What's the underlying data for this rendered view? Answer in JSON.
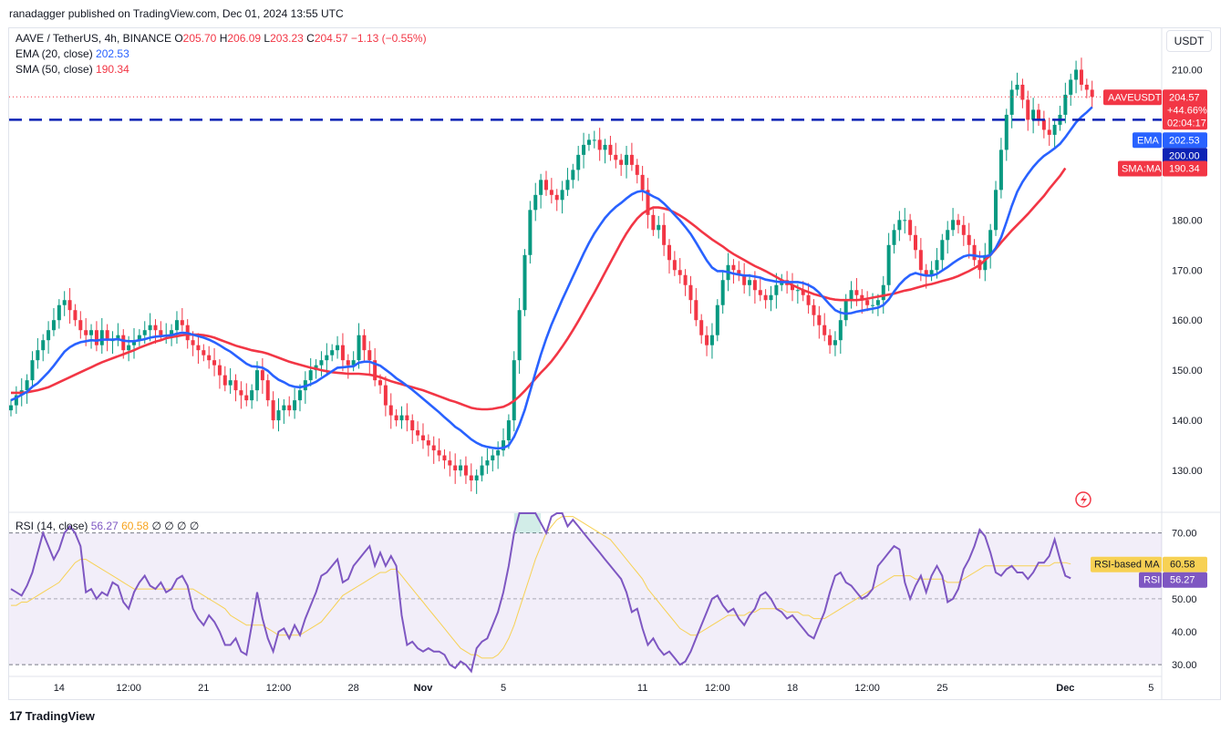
{
  "header": {
    "publisher": "ranadagger published on TradingView.com, Dec 01, 2024 13:55 UTC"
  },
  "legend": {
    "symbol": "AAVE / TetherUS, 4h, BINANCE",
    "o_label": "O",
    "o": "205.70",
    "h_label": "H",
    "h": "206.09",
    "l_label": "L",
    "l": "203.23",
    "c_label": "C",
    "c": "204.57",
    "change": "−1.13 (−0.55%)",
    "ema_label": "EMA (20, close)",
    "ema": "202.53",
    "sma_label": "SMA (50, close)",
    "sma": "190.34"
  },
  "rsi_legend": {
    "label": "RSI (14, close)",
    "rsi": "56.27",
    "ma": "60.58",
    "extra": "∅ ∅ ∅ ∅"
  },
  "currency_button": "USDT",
  "footer": {
    "brand": "TradingView",
    "logo": "17"
  },
  "colors": {
    "up": "#089981",
    "down": "#f23645",
    "ema": "#2962ff",
    "sma": "#f23645",
    "rsi": "#7e57c2",
    "rsi_ma": "#f7d154",
    "level": "#0d23b5"
  },
  "chart_data": [
    {
      "type": "candlestick",
      "title": "AAVE / TetherUS, 4h, BINANCE",
      "ylim": [
        122,
        217
      ],
      "y_ticks": [
        "210.00",
        "200.00",
        "190.00",
        "180.00",
        "170.00",
        "160.00",
        "150.00",
        "140.00",
        "130.00"
      ],
      "x_ticks": [
        {
          "label": "14",
          "i": 9
        },
        {
          "label": "12:00",
          "i": 22
        },
        {
          "label": "21",
          "i": 36
        },
        {
          "label": "12:00",
          "i": 50
        },
        {
          "label": "28",
          "i": 64
        },
        {
          "label": "Nov",
          "i": 77
        },
        {
          "label": "5",
          "i": 92
        },
        {
          "label": "11",
          "i": 118
        },
        {
          "label": "12:00",
          "i": 132
        },
        {
          "label": "18",
          "i": 146
        },
        {
          "label": "12:00",
          "i": 160
        },
        {
          "label": "25",
          "i": 174
        },
        {
          "label": "Dec",
          "i": 197
        },
        {
          "label": "5",
          "i": 213
        }
      ],
      "close": [
        143,
        145,
        146,
        148,
        152,
        154,
        156,
        158,
        160,
        163,
        164,
        162,
        160,
        158,
        157,
        158,
        155,
        158,
        156,
        156,
        157,
        154,
        155,
        156,
        157,
        158,
        159,
        158,
        157,
        157,
        158,
        160,
        159,
        156,
        155,
        154,
        153,
        152,
        151,
        149,
        147,
        148,
        146,
        145,
        144,
        146,
        150,
        148,
        144,
        140,
        142,
        143,
        142,
        144,
        146,
        148,
        150,
        151,
        152,
        153,
        154,
        155,
        152,
        151,
        152,
        157,
        154,
        152,
        148,
        147,
        143,
        141,
        140,
        141,
        140,
        138,
        137,
        136,
        135,
        134,
        133,
        132,
        131,
        130,
        131,
        129,
        128,
        129,
        131,
        132,
        133,
        134,
        136,
        140,
        152,
        162,
        173,
        182,
        185,
        188,
        186,
        185,
        184,
        186,
        188,
        190,
        193,
        195,
        196,
        196,
        194,
        195,
        193,
        192,
        191,
        193,
        191,
        189,
        186,
        181,
        178,
        179,
        175,
        172,
        170,
        169,
        167,
        164,
        160,
        157,
        155,
        157,
        163,
        168,
        171,
        170,
        169,
        167,
        168,
        166,
        165,
        164,
        165,
        167,
        168,
        167,
        166,
        166,
        165,
        163,
        161,
        159,
        157,
        155,
        156,
        160,
        164,
        166,
        165,
        164,
        163,
        163,
        164,
        167,
        175,
        178,
        180,
        180,
        177,
        174,
        170,
        169,
        170,
        172,
        176,
        178,
        180,
        179,
        177,
        175,
        172,
        170,
        173,
        178,
        186,
        194,
        201,
        206,
        207,
        204,
        200,
        202,
        200,
        198,
        197,
        199,
        201,
        205,
        208,
        210,
        207,
        206,
        204.57
      ],
      "ema": [
        144,
        144.5,
        145.1,
        145.7,
        146.7,
        147.4,
        148.5,
        149.6,
        150.9,
        152.3,
        153.7,
        154.6,
        155.2,
        155.6,
        155.8,
        156.0,
        155.9,
        156.1,
        156.1,
        156.1,
        156.2,
        155.9,
        155.8,
        155.8,
        156.0,
        156.2,
        156.5,
        156.7,
        156.8,
        156.9,
        157.0,
        157.3,
        157.5,
        157.4,
        157.1,
        156.8,
        156.5,
        156.1,
        155.6,
        155.0,
        154.3,
        153.7,
        152.9,
        152.1,
        151.3,
        150.8,
        150.7,
        150.5,
        149.9,
        148.9,
        148.1,
        147.6,
        147.0,
        146.7,
        146.6,
        146.8,
        147.2,
        147.7,
        148.4,
        149.1,
        149.8,
        150.5,
        150.6,
        150.7,
        150.8,
        151.5,
        151.7,
        151.7,
        151.3,
        150.9,
        150.1,
        149.3,
        148.4,
        147.7,
        146.9,
        146.1,
        145.2,
        144.3,
        143.4,
        142.5,
        141.6,
        140.6,
        139.7,
        138.7,
        138.0,
        137.1,
        136.2,
        135.5,
        135.0,
        134.7,
        134.5,
        134.4,
        134.5,
        135.0,
        136.7,
        139.1,
        142.1,
        145.8,
        149.5,
        153.1,
        156.3,
        159.1,
        161.6,
        164.1,
        166.4,
        168.7,
        171.0,
        173.3,
        175.4,
        177.3,
        178.9,
        180.4,
        181.6,
        182.6,
        183.4,
        184.3,
        185.1,
        185.6,
        185.8,
        185.3,
        184.7,
        184.2,
        183.3,
        182.2,
        181.0,
        179.9,
        178.6,
        177.2,
        175.5,
        173.7,
        171.9,
        170.5,
        169.8,
        169.8,
        169.6,
        169.3,
        169.1,
        168.9,
        168.9,
        168.7,
        168.5,
        168.1,
        167.9,
        167.7,
        167.6,
        167.6,
        167.6,
        167.6,
        167.4,
        167.0,
        166.4,
        165.5,
        164.3,
        163.1,
        162.0,
        161.5,
        161.3,
        161.4,
        161.7,
        161.9,
        162.1,
        162.3,
        162.5,
        163.0,
        164.1,
        165.7,
        167.1,
        168.2,
        169.0,
        169.4,
        169.1,
        168.9,
        168.9,
        169.2,
        169.9,
        170.6,
        171.4,
        172.1,
        172.7,
        173.0,
        172.9,
        172.7,
        172.7,
        173.0,
        174.4,
        176.5,
        179.6,
        182.8,
        185.6,
        187.6,
        189.2,
        190.6,
        191.8,
        192.8,
        193.5,
        194.3,
        195.2,
        196.5,
        198.0,
        199.5,
        200.6,
        201.5,
        202.53
      ],
      "sma": [
        145.5,
        145.5,
        145.5,
        145.6,
        145.8,
        146.0,
        146.3,
        146.6,
        147.1,
        147.6,
        148.1,
        148.6,
        149.1,
        149.6,
        150.1,
        150.6,
        151.1,
        151.6,
        152.0,
        152.4,
        152.8,
        153.2,
        153.6,
        154.0,
        154.5,
        154.9,
        155.3,
        155.7,
        156.0,
        156.4,
        156.6,
        156.8,
        157.0,
        157.1,
        157.1,
        157.1,
        157.0,
        156.8,
        156.5,
        156.1,
        155.7,
        155.3,
        154.9,
        154.6,
        154.3,
        154.0,
        153.8,
        153.6,
        153.3,
        152.9,
        152.5,
        152.1,
        151.7,
        151.4,
        151.1,
        150.8,
        150.5,
        150.3,
        150.0,
        149.8,
        149.6,
        149.5,
        149.4,
        149.3,
        149.3,
        149.3,
        149.2,
        149.1,
        148.9,
        148.6,
        148.2,
        147.8,
        147.5,
        147.2,
        146.9,
        146.6,
        146.3,
        146.0,
        145.6,
        145.2,
        144.8,
        144.4,
        144.0,
        143.7,
        143.3,
        142.9,
        142.5,
        142.3,
        142.2,
        142.2,
        142.3,
        142.5,
        142.7,
        143.2,
        143.9,
        144.8,
        145.9,
        147.1,
        148.3,
        149.5,
        150.6,
        151.8,
        153.2,
        154.7,
        156.3,
        158.0,
        159.8,
        161.7,
        163.6,
        165.5,
        167.5,
        169.5,
        171.5,
        173.5,
        175.5,
        177.3,
        178.9,
        180.3,
        181.3,
        182.0,
        182.5,
        182.5,
        182.3,
        182.0,
        181.5,
        180.9,
        180.2,
        179.4,
        178.6,
        177.7,
        176.9,
        176.1,
        175.4,
        174.7,
        173.9,
        173.2,
        172.6,
        172.0,
        171.4,
        170.8,
        170.3,
        169.8,
        169.2,
        168.6,
        168.0,
        167.5,
        167.0,
        166.5,
        166.0,
        165.6,
        165.2,
        164.9,
        164.6,
        164.3,
        164.1,
        164.0,
        164.0,
        164.0,
        164.0,
        164.1,
        164.3,
        164.5,
        164.7,
        164.9,
        165.1,
        165.3,
        165.6,
        165.9,
        166.1,
        166.4,
        166.7,
        167.0,
        167.2,
        167.5,
        167.8,
        168.1,
        168.4,
        168.8,
        169.3,
        169.8,
        170.4,
        171.0,
        172.0,
        173.0,
        174.2,
        175.5,
        176.7,
        177.9,
        179.0,
        180.1,
        181.2,
        182.4,
        183.6,
        184.8,
        186.2,
        187.5,
        188.8,
        190.34
      ],
      "horizontal_levels": [
        {
          "price": 200,
          "style": "dashed",
          "color": "#0d23b5"
        },
        {
          "price": 204.57,
          "style": "dotted",
          "color": "#f23645"
        }
      ],
      "price_labels": [
        {
          "text": "AAVEUSDT",
          "value": "204.57",
          "change": "+44.66%",
          "timer": "02:04:17",
          "price": 204.57,
          "color": "#f23645"
        },
        {
          "text": "EMA",
          "value": "202.53",
          "price": 202.53,
          "color": "#2962ff"
        },
        {
          "text": "",
          "value": "200.00",
          "price": 200,
          "color": "#0d23b5"
        },
        {
          "text": "SMA:MA",
          "value": "190.34",
          "price": 190.34,
          "color": "#f23645"
        }
      ]
    },
    {
      "type": "line",
      "title": "RSI (14, close)",
      "ylim": [
        27,
        76
      ],
      "y_ticks": [
        "70.00",
        "60.00",
        "50.00",
        "40.00",
        "30.00"
      ],
      "band": [
        30,
        70
      ],
      "midline": 50,
      "rsi": [
        53,
        52,
        51,
        54,
        58,
        64,
        70,
        66,
        62,
        65,
        70,
        72,
        70,
        66,
        52,
        53,
        50,
        52,
        51,
        55,
        54,
        49,
        47,
        52,
        55,
        57,
        54,
        53,
        55,
        52,
        53,
        56,
        57,
        54,
        47,
        44,
        42,
        45,
        43,
        40,
        36,
        36,
        38,
        34,
        33,
        42,
        52,
        44,
        38,
        34,
        40,
        41,
        38,
        42,
        39,
        44,
        48,
        52,
        57,
        58,
        60,
        62,
        55,
        56,
        60,
        62,
        64,
        66,
        60,
        64,
        60,
        63,
        60,
        45,
        36,
        37,
        35,
        34,
        35,
        34,
        34,
        33,
        30,
        29,
        31,
        30,
        28,
        35,
        37,
        38,
        42,
        46,
        52,
        60,
        70,
        76,
        80,
        78,
        76,
        73,
        70,
        75,
        78,
        76,
        72,
        74,
        72,
        70,
        68,
        66,
        64,
        62,
        60,
        58,
        56,
        52,
        46,
        47,
        41,
        36,
        38,
        35,
        33,
        34,
        32,
        30,
        31,
        34,
        38,
        42,
        46,
        50,
        51,
        48,
        46,
        47,
        44,
        42,
        45,
        47,
        51,
        52,
        50,
        47,
        46,
        44,
        45,
        43,
        41,
        39,
        38,
        42,
        46,
        52,
        57,
        58,
        55,
        54,
        52,
        50,
        51,
        53,
        60,
        62,
        64,
        66,
        65,
        55,
        50,
        54,
        57,
        52,
        57,
        60,
        57,
        49,
        50,
        53,
        59,
        62,
        66,
        71,
        69,
        64,
        58,
        57,
        59,
        60,
        58,
        58,
        56,
        58,
        61,
        61,
        63,
        68,
        62,
        57,
        56.27
      ],
      "rsi_ma": [
        48,
        48,
        49,
        49,
        50,
        51,
        52,
        53,
        54,
        55,
        57,
        59,
        61,
        62,
        62,
        61,
        60,
        59,
        58,
        57,
        56,
        55,
        54,
        53,
        53,
        53,
        53,
        53,
        53,
        53,
        53,
        53,
        53,
        53,
        53,
        52,
        51,
        50,
        49,
        48,
        47,
        45,
        44,
        43,
        42,
        42,
        42,
        42,
        41,
        40,
        39,
        39,
        39,
        39,
        39,
        40,
        41,
        42,
        43,
        45,
        47,
        49,
        51,
        52,
        53,
        54,
        55,
        56,
        57,
        58,
        58,
        59,
        59,
        57,
        55,
        53,
        51,
        49,
        47,
        45,
        43,
        41,
        39,
        37,
        35,
        34,
        33,
        33,
        32,
        32,
        32,
        33,
        35,
        38,
        42,
        47,
        52,
        57,
        62,
        66,
        70,
        72,
        74,
        75,
        75,
        75,
        74,
        73,
        72,
        71,
        70,
        69,
        68,
        66,
        64,
        62,
        60,
        58,
        56,
        53,
        51,
        49,
        47,
        45,
        43,
        41,
        40,
        39,
        39,
        40,
        41,
        42,
        43,
        44,
        45,
        45,
        45,
        45,
        46,
        46,
        47,
        47,
        47,
        47,
        47,
        46,
        46,
        46,
        45,
        45,
        44,
        44,
        44,
        45,
        46,
        47,
        48,
        49,
        50,
        51,
        52,
        53,
        54,
        55,
        56,
        57,
        57,
        57,
        57,
        56,
        56,
        56,
        56,
        56,
        56,
        55,
        55,
        55,
        56,
        57,
        58,
        59,
        60,
        60,
        60,
        60,
        60,
        60,
        60,
        60,
        60,
        60,
        60,
        60,
        60,
        61,
        61,
        61,
        60.58
      ],
      "price_labels": [
        {
          "text": "RSI-based MA",
          "value": "60.58",
          "color": "#f7d154"
        },
        {
          "text": "RSI",
          "value": "56.27",
          "color": "#7e57c2"
        }
      ]
    }
  ]
}
